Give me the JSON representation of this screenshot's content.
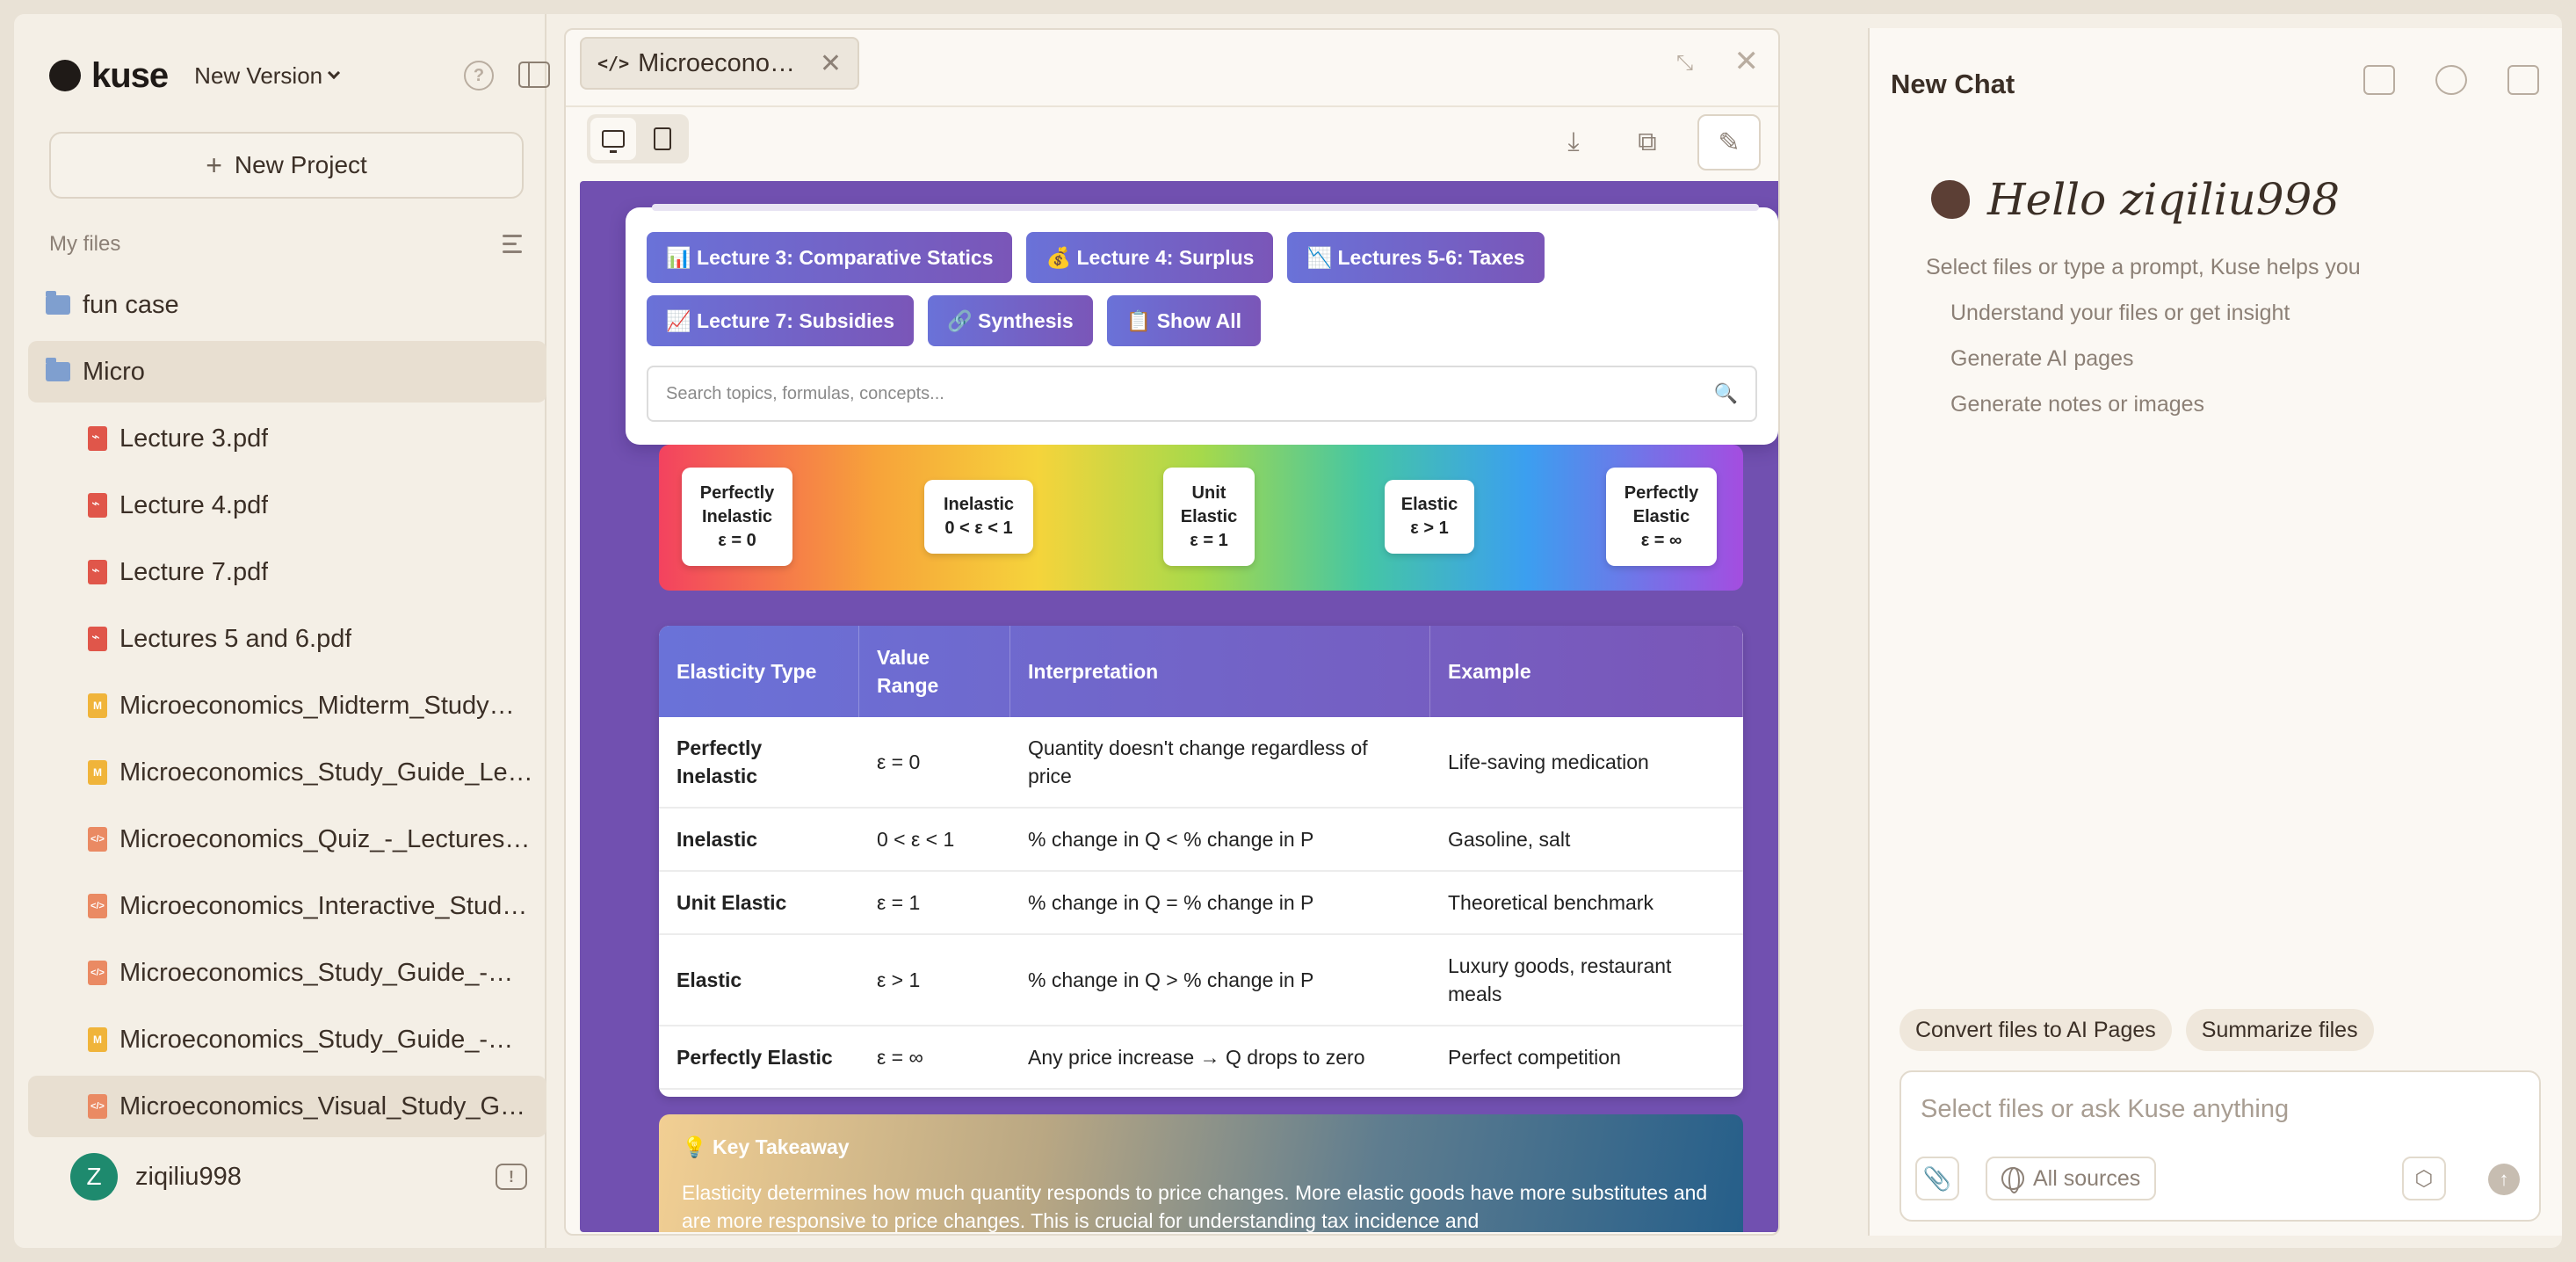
{
  "app": {
    "brand": "kuse",
    "version_label": "New Version"
  },
  "sidebar": {
    "new_project_label": "New Project",
    "files_heading": "My files",
    "items": [
      {
        "name": "fun case",
        "type": "folder",
        "level": 0,
        "selected": false
      },
      {
        "name": "Micro",
        "type": "folder",
        "level": 0,
        "selected": true
      },
      {
        "name": "Lecture 3.pdf",
        "type": "pdf",
        "level": 1,
        "selected": false
      },
      {
        "name": "Lecture 4.pdf",
        "type": "pdf",
        "level": 1,
        "selected": false
      },
      {
        "name": "Lecture 7.pdf",
        "type": "pdf",
        "level": 1,
        "selected": false
      },
      {
        "name": "Lectures 5 and 6.pdf",
        "type": "pdf",
        "level": 1,
        "selected": false
      },
      {
        "name": "Microeconomics_Midterm_Study…",
        "type": "md",
        "level": 1,
        "selected": false
      },
      {
        "name": "Microeconomics_Study_Guide_Le…",
        "type": "md",
        "level": 1,
        "selected": false
      },
      {
        "name": "Microeconomics_Quiz_-_Lectures…",
        "type": "html",
        "level": 1,
        "selected": false
      },
      {
        "name": "Microeconomics_Interactive_Stud…",
        "type": "html",
        "level": 1,
        "selected": false
      },
      {
        "name": "Microeconomics_Study_Guide_-…",
        "type": "html",
        "level": 1,
        "selected": false
      },
      {
        "name": "Microeconomics_Study_Guide_-…",
        "type": "md",
        "level": 1,
        "selected": false
      },
      {
        "name": "Microeconomics_Visual_Study_G…",
        "type": "html",
        "level": 1,
        "selected": true
      }
    ],
    "user": {
      "initial": "Z",
      "name": "ziqiliu998",
      "avatar_color": "#1e8a6e"
    }
  },
  "preview": {
    "tab_title": "Microecono…",
    "nav_chips_row1": [
      "📊 Lecture 3: Comparative Statics",
      "💰 Lecture 4: Surplus",
      "📉 Lectures 5-6: Taxes"
    ],
    "nav_chips_row2": [
      "📈 Lecture 7: Subsidies",
      "🔗 Synthesis",
      "📋 Show All"
    ],
    "search_placeholder": "Search topics, formulas, concepts...",
    "spectrum": [
      {
        "line1": "Perfectly",
        "line2": "Inelastic",
        "line3": "ε = 0"
      },
      {
        "line1": "Inelastic",
        "line2": "0 < ε < 1",
        "line3": ""
      },
      {
        "line1": "Unit",
        "line2": "Elastic",
        "line3": "ε = 1"
      },
      {
        "line1": "Elastic",
        "line2": "ε > 1",
        "line3": ""
      },
      {
        "line1": "Perfectly",
        "line2": "Elastic",
        "line3": "ε = ∞"
      }
    ],
    "table": {
      "headers": [
        "Elasticity Type",
        "Value Range",
        "Interpretation",
        "Example"
      ],
      "rows": [
        [
          "Perfectly Inelastic",
          "ε = 0",
          "Quantity doesn't change regardless of price",
          "Life-saving medication"
        ],
        [
          "Inelastic",
          "0 < ε < 1",
          "% change in Q < % change in P",
          "Gasoline, salt"
        ],
        [
          "Unit Elastic",
          "ε = 1",
          "% change in Q = % change in P",
          "Theoretical benchmark"
        ],
        [
          "Elastic",
          "ε > 1",
          "% change in Q > % change in P",
          "Luxury goods, restaurant meals"
        ],
        [
          "Perfectly Elastic",
          "ε = ∞",
          "Any price increase → Q drops to zero",
          "Perfect competition"
        ]
      ]
    },
    "takeaway": {
      "title": "💡 Key Takeaway",
      "text": "Elasticity determines how much quantity responds to price changes. More elastic goods have more substitutes and are more responsive to price changes. This is crucial for understanding tax incidence and"
    }
  },
  "chat": {
    "title": "New Chat",
    "greeting": "Hello ziqiliu998",
    "subtitle": "Select files or type a prompt, Kuse helps you",
    "suggestions": [
      "Understand your files or get insight",
      "Generate AI pages",
      "Generate notes or images"
    ],
    "quick_actions": [
      "Convert files to AI Pages",
      "Summarize files"
    ],
    "input_placeholder": "Select files or ask Kuse anything",
    "sources_label": "All sources"
  }
}
